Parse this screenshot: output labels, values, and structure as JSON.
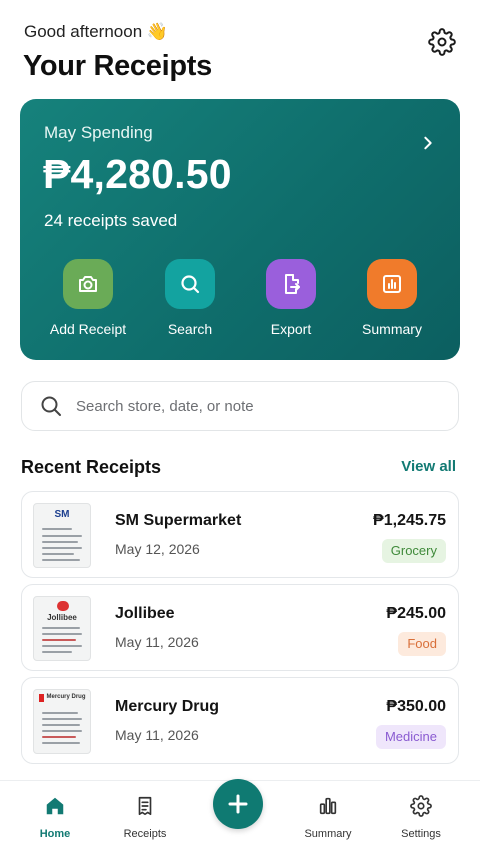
{
  "header": {
    "greeting": "Good afternoon",
    "wave_emoji": "👋",
    "title": "Your Receipts",
    "settings_icon": "gear-icon"
  },
  "summary_card": {
    "label": "May Spending",
    "amount": "₱4,280.50",
    "receipt_count": "24 receipts saved",
    "chevron_icon": "chevron-right-icon",
    "actions": [
      {
        "label": "Add Receipt",
        "icon": "camera-icon",
        "color": "#6aab57"
      },
      {
        "label": "Search",
        "icon": "search-icon",
        "color": "#13a3a0"
      },
      {
        "label": "Export",
        "icon": "export-file-icon",
        "color": "#9a5fdc"
      },
      {
        "label": "Summary",
        "icon": "bar-chart-icon",
        "color": "#f07b2b"
      }
    ]
  },
  "search": {
    "placeholder": "Search store, date, or note"
  },
  "recent": {
    "title": "Recent Receipts",
    "view_all": "View all",
    "items": [
      {
        "store": "SM Supermarket",
        "date": "May 12, 2026",
        "amount": "₱1,245.75",
        "category": "Grocery",
        "tag_bg": "#e6f4e2",
        "tag_fg": "#3f8a3a",
        "thumb_logo": "SM"
      },
      {
        "store": "Jollibee",
        "date": "May 11, 2026",
        "amount": "₱245.00",
        "category": "Food",
        "tag_bg": "#fdeadd",
        "tag_fg": "#d9703a",
        "thumb_logo": "Jollibee"
      },
      {
        "store": "Mercury Drug",
        "date": "May 11, 2026",
        "amount": "₱350.00",
        "category": "Medicine",
        "tag_bg": "#efe6fb",
        "tag_fg": "#8a5bd1",
        "thumb_logo": "Mercury Drug"
      }
    ]
  },
  "bottom_nav": {
    "items": [
      {
        "label": "Home",
        "icon": "home-icon",
        "active": true
      },
      {
        "label": "Receipts",
        "icon": "receipt-icon",
        "active": false
      },
      {
        "label": "Summary",
        "icon": "bar-chart-icon",
        "active": false
      },
      {
        "label": "Settings",
        "icon": "gear-icon",
        "active": false
      }
    ],
    "fab_icon": "plus-icon"
  },
  "colors": {
    "accent": "#127a73",
    "hero_bg": "#0f6e6c"
  }
}
